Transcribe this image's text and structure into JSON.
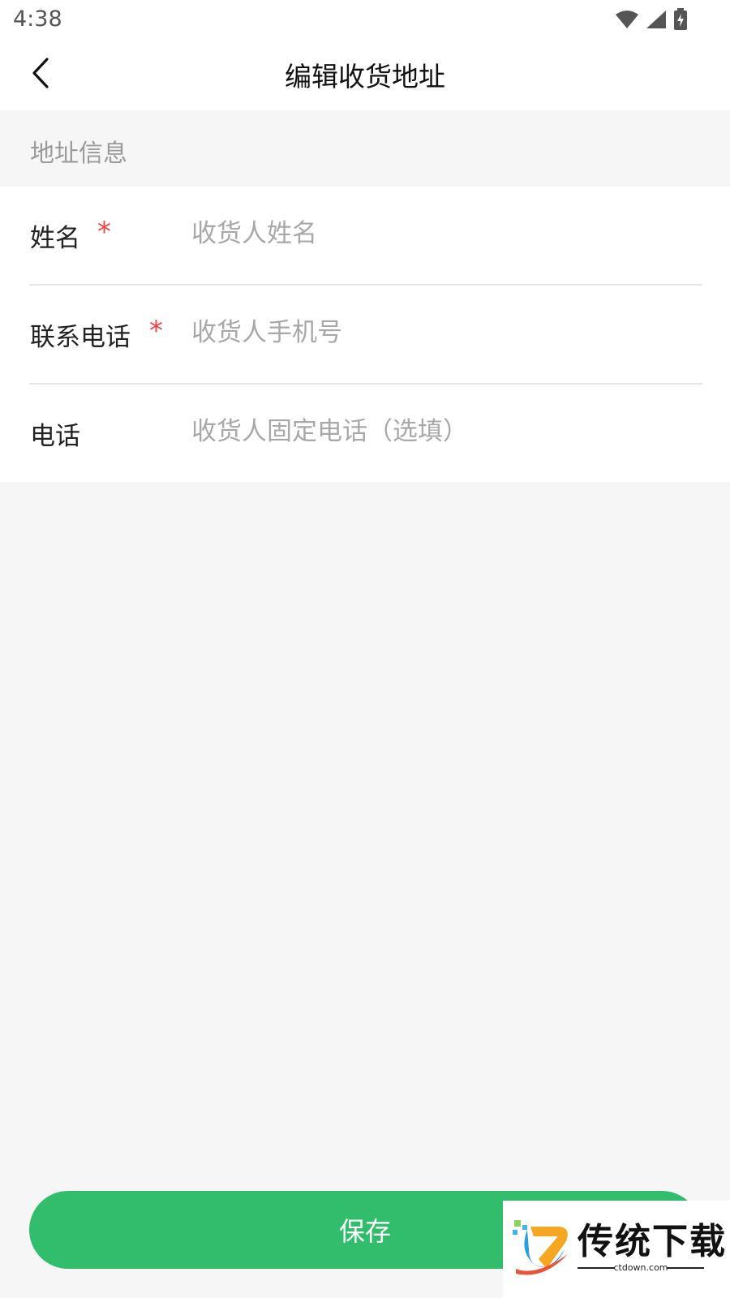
{
  "status_bar": {
    "time": "4:38",
    "icons": [
      "wifi-icon",
      "cellular-signal-icon",
      "battery-charging-icon"
    ]
  },
  "nav": {
    "back_icon": "chevron-left-icon",
    "title": "编辑收货地址"
  },
  "section": {
    "label": "地址信息"
  },
  "form": {
    "name": {
      "label": "姓名",
      "required": "*",
      "placeholder": "收货人姓名",
      "value": ""
    },
    "mobile": {
      "label": "联系电话",
      "required": "*",
      "placeholder": "收货人手机号",
      "value": ""
    },
    "phone": {
      "label": "电话",
      "placeholder": "收货人固定电话（选填）",
      "value": ""
    }
  },
  "actions": {
    "save_label": "保存"
  },
  "watermark": {
    "text": "传统下载",
    "sub": "ctdown.com"
  },
  "colors": {
    "accent": "#31bd6b",
    "required": "#f04141",
    "background": "#f6f6f6",
    "placeholder": "#a8a8a8"
  }
}
